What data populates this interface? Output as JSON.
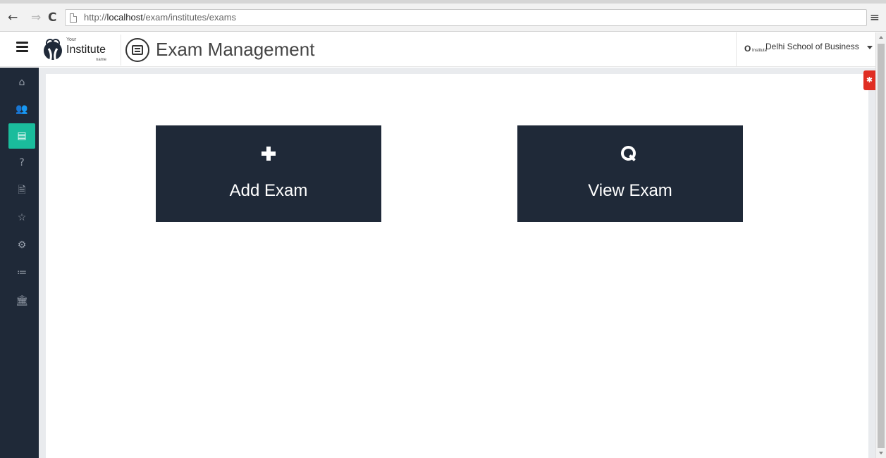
{
  "browser": {
    "back_icon": "←",
    "forward_icon": "⇒",
    "reload_icon": "C",
    "url_scheme": "http://",
    "url_host": "localhost",
    "url_path": "/exam/institutes/exams",
    "menu_icon": "≡"
  },
  "header": {
    "logo_small": "Your",
    "logo_main": "Institute",
    "logo_sub": "name",
    "title": "Exam Management",
    "institution_logo": "O",
    "institution_logo_small": "Institute",
    "institution": "Delhi School of Business"
  },
  "sidebar": {
    "items": [
      {
        "name": "home-icon",
        "glyph": "⌂"
      },
      {
        "name": "users-icon",
        "glyph": "👥"
      },
      {
        "name": "exams-icon",
        "glyph": "▤",
        "active": true
      },
      {
        "name": "help-icon",
        "glyph": "?"
      },
      {
        "name": "document-icon",
        "glyph": "🗎"
      },
      {
        "name": "star-icon",
        "glyph": "☆"
      },
      {
        "name": "gear-icon",
        "glyph": "⚙"
      },
      {
        "name": "list-icon",
        "glyph": "≔"
      },
      {
        "name": "institution-icon",
        "glyph": "🏛"
      }
    ]
  },
  "main": {
    "add_label": "Add Exam",
    "view_label": "View Exam"
  },
  "badge": {
    "icon": "bug-icon",
    "glyph": "✱"
  },
  "colors": {
    "tile": "#1f2938",
    "sidebar": "#1f2938",
    "active": "#1abc9c",
    "bug": "#e02d22"
  }
}
